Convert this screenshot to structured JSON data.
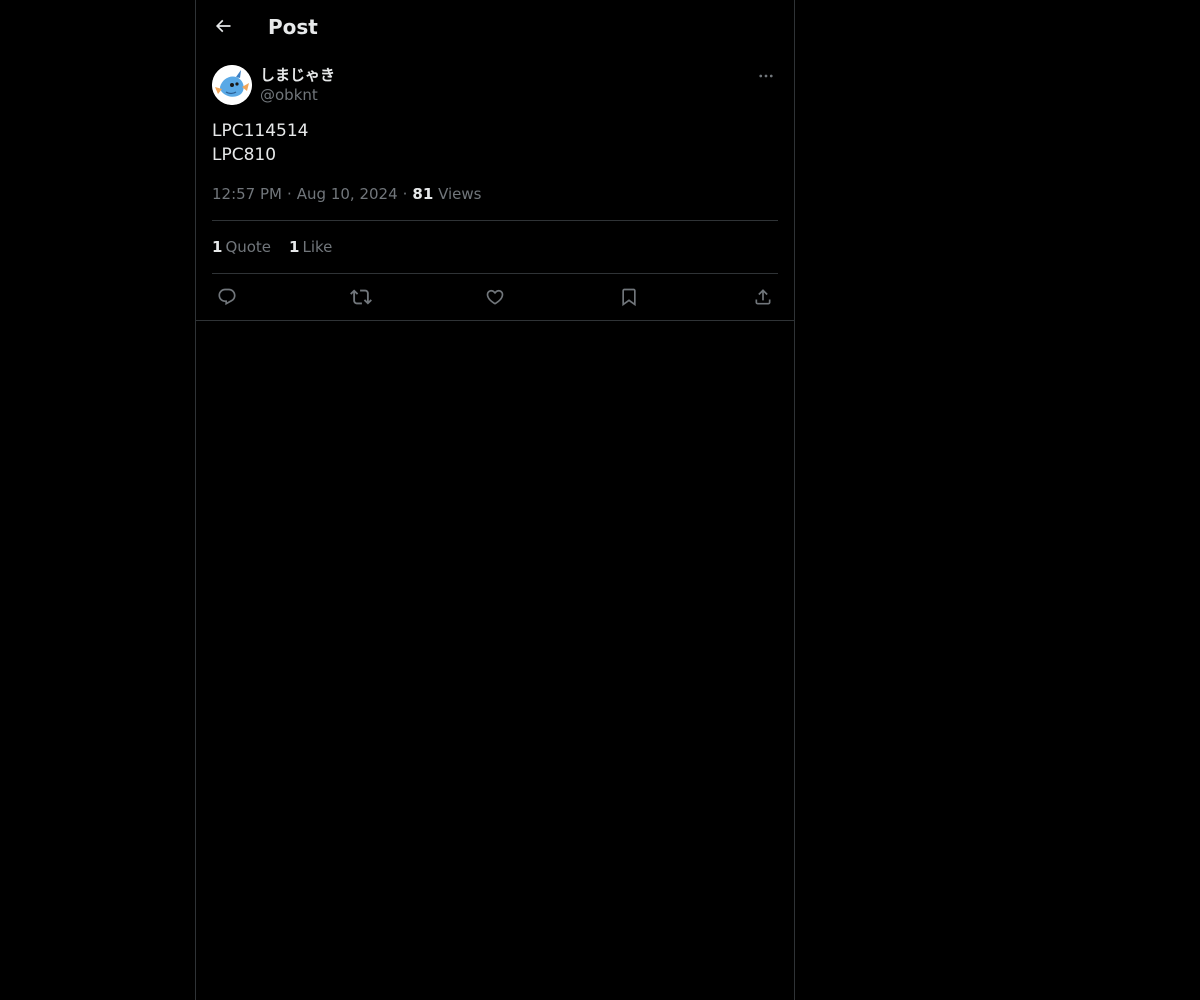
{
  "header": {
    "title": "Post",
    "back_icon": "arrow-left-icon"
  },
  "post": {
    "author": {
      "display_name": "しまじゃき",
      "handle": "@obknt",
      "avatar_icon": "avatar-image"
    },
    "text_lines": [
      "LPC114514",
      "LPC810"
    ],
    "time": "12:57 PM",
    "date": "Aug 10, 2024",
    "separator": "·",
    "views_count": "81",
    "views_label": "Views",
    "stats": {
      "quotes_count": "1",
      "quotes_label": "Quote",
      "likes_count": "1",
      "likes_label": "Like"
    },
    "actions": {
      "reply_icon": "reply-icon",
      "repost_icon": "repost-icon",
      "like_icon": "heart-icon",
      "bookmark_icon": "bookmark-icon",
      "share_icon": "share-icon"
    }
  },
  "colors": {
    "background": "#000000",
    "text_primary": "#e7e9ea",
    "text_secondary": "#71767b",
    "border": "#2f3336"
  }
}
